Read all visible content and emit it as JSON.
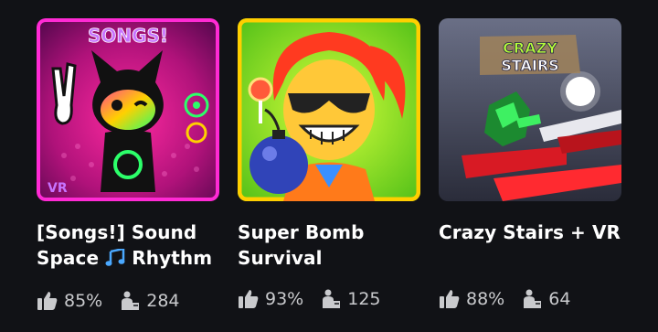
{
  "games": [
    {
      "thumb_text": "SONGS!",
      "thumb_badge": "VR",
      "title_line1": "[Songs!] Sound",
      "title_line2a": "Space ",
      "title_line2b": " Rhythm",
      "title_icon": "musical-notes-icon",
      "rating": "85%",
      "players": "284"
    },
    {
      "title_line1": "Super Bomb",
      "title_line2a": "Survival",
      "rating": "93%",
      "players": "125"
    },
    {
      "thumb_text_1": "CRAZY",
      "thumb_text_2": "STAIRS",
      "title_line1": "Crazy Stairs + VR",
      "rating": "88%",
      "players": "64"
    }
  ],
  "icons": {
    "rating": "thumbs-up-icon",
    "players": "players-icon"
  },
  "colors": {
    "background": "#111216",
    "stat_text": "#c9cacd",
    "note": "#4aa8ff"
  }
}
